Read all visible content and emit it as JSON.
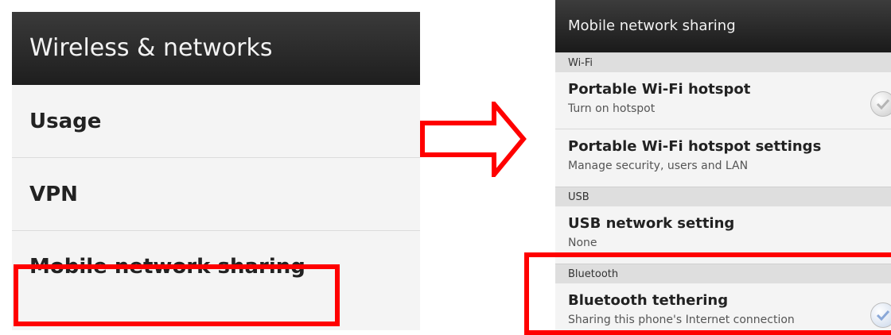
{
  "left": {
    "header": "Wireless & networks",
    "items": [
      {
        "label": "Usage"
      },
      {
        "label": "VPN"
      },
      {
        "label": "Mobile network sharing"
      }
    ]
  },
  "right": {
    "header": "Mobile network sharing",
    "sections": [
      {
        "title": "Wi-Fi"
      },
      {
        "title": "USB"
      },
      {
        "title": "Bluetooth"
      }
    ],
    "rows": [
      {
        "title": "Portable Wi-Fi hotspot",
        "subtitle": "Turn on hotspot"
      },
      {
        "title": "Portable Wi-Fi hotspot settings",
        "subtitle": "Manage security, users and LAN"
      },
      {
        "title": "USB network setting",
        "subtitle": "None"
      },
      {
        "title": "Bluetooth tethering",
        "subtitle": "Sharing this phone's Internet connection"
      }
    ]
  },
  "colors": {
    "highlight": "#ff0000",
    "header_bg": "#222222",
    "list_bg": "#f4f4f4",
    "section_bg": "#dedede"
  },
  "icons": {
    "arrow": "right-arrow-icon",
    "checkbox": "checkbox-icon"
  }
}
